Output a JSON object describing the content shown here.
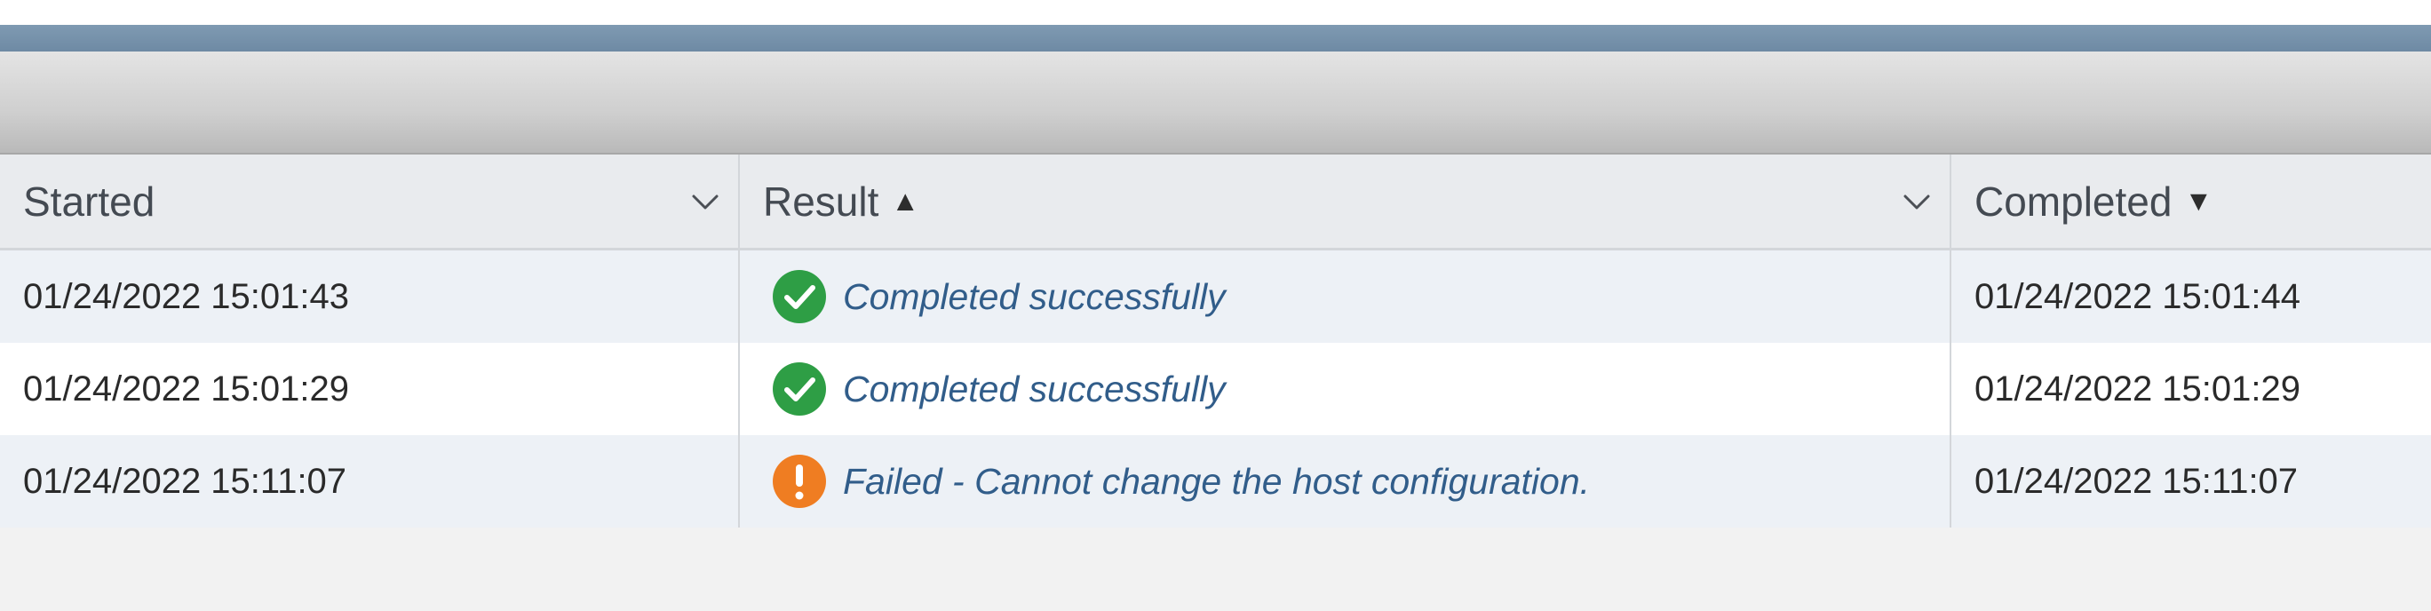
{
  "table": {
    "columns": {
      "started": "Started",
      "result": "Result",
      "completed": "Completed"
    },
    "sort_indicators": {
      "result": "▲",
      "completed": "▼"
    },
    "rows": [
      {
        "started": "01/24/2022 15:01:43",
        "result": "Completed successfully",
        "status": "success",
        "icon": "check-circle-icon",
        "completed": "01/24/2022 15:01:44"
      },
      {
        "started": "01/24/2022 15:01:29",
        "result": "Completed successfully",
        "status": "success",
        "icon": "check-circle-icon",
        "completed": "01/24/2022 15:01:29"
      },
      {
        "started": "01/24/2022 15:11:07",
        "result": "Failed - Cannot change the host configuration.",
        "status": "failed",
        "icon": "warning-circle-icon",
        "completed": "01/24/2022 15:11:07"
      }
    ]
  },
  "colors": {
    "success": "#2e9e45",
    "failed": "#ef7d22",
    "link_text": "#315d8a",
    "header_background": "#e9ebee",
    "blue_bar": "#728ea8"
  }
}
